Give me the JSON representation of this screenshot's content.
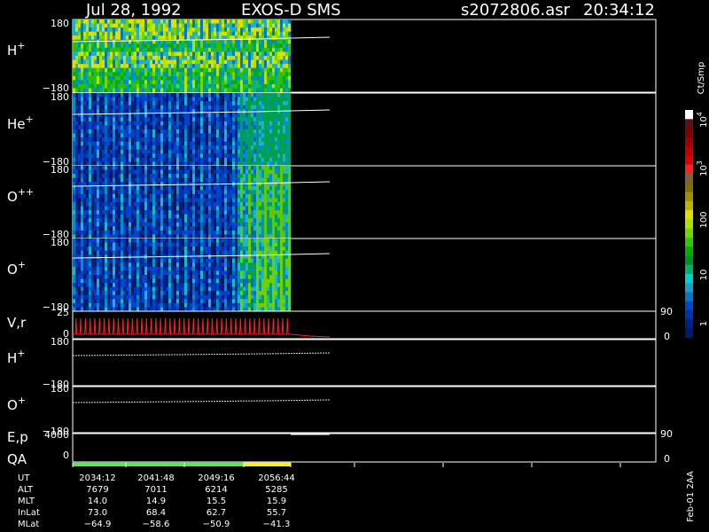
{
  "header": {
    "date": "Jul 28, 1992",
    "instrument": "EXOS-D SMS",
    "filename": "s2072806.asr",
    "time": "20:34:12"
  },
  "colors": {
    "axis": "#ffffff",
    "background": "#000000",
    "qa_green": "#59e852",
    "qa_yellow": "#f5ee2d",
    "red_trace": "#ff2020"
  },
  "panels": [
    {
      "label_main": "H",
      "label_sup": "+",
      "ymax": "180",
      "ymin": "−180"
    },
    {
      "label_main": "He",
      "label_sup": "+",
      "ymax": "180",
      "ymin": "−180"
    },
    {
      "label_main": "O",
      "label_sup": "++",
      "ymax": "180",
      "ymin": "−180"
    },
    {
      "label_main": "O",
      "label_sup": "+",
      "ymax": "180",
      "ymin": "−180"
    }
  ],
  "lower_panels": {
    "vr": {
      "label": "V,r",
      "ymax": "25",
      "ymin": "0",
      "right_max": "90",
      "right_min": "0"
    },
    "h_plus": {
      "label_main": "H",
      "label_sup": "+",
      "ymax": "180",
      "ymin": "−180"
    },
    "o_plus": {
      "label_main": "O",
      "label_sup": "+",
      "ymax": "180",
      "ymin": "−180"
    },
    "ep": {
      "label": "E,p",
      "label2": "QA",
      "ymax": "4000",
      "ymin": "0",
      "right_max": "90",
      "right_min": "0"
    }
  },
  "colorbar": {
    "unit": "Ct/Smp",
    "ticks": [
      {
        "label": "1",
        "base": "1",
        "exp": ""
      },
      {
        "label": "10",
        "base": "10",
        "exp": ""
      },
      {
        "label": "100",
        "base": "100",
        "exp": ""
      },
      {
        "label": "10",
        "base": "10",
        "exp": "3"
      },
      {
        "label": "10",
        "base": "10",
        "exp": "4"
      }
    ],
    "colors": [
      "#001a66",
      "#001f88",
      "#0032aa",
      "#0044cc",
      "#0078c8",
      "#1aa0c8",
      "#00d0d0",
      "#00b070",
      "#009028",
      "#00b000",
      "#30c800",
      "#70d800",
      "#b0e000",
      "#e0e000",
      "#c0b000",
      "#a09000",
      "#807000",
      "#806040",
      "#ff2020",
      "#e00000",
      "#c00000",
      "#a00000",
      "#800000",
      "#601010",
      "#ffffff"
    ]
  },
  "footer": {
    "rows": [
      {
        "name": "UT",
        "values": [
          "2034:12",
          "2041:48",
          "2049:16",
          "2056:44"
        ]
      },
      {
        "name": "ALT",
        "values": [
          "7679",
          "7011",
          "6214",
          "5285"
        ]
      },
      {
        "name": "MLT",
        "values": [
          "14.0",
          "14.9",
          "15.5",
          "15.9"
        ]
      },
      {
        "name": "InLat",
        "values": [
          "73.0",
          "68.4",
          "62.7",
          "55.7"
        ]
      },
      {
        "name": "MLat",
        "values": [
          "−64.9",
          "−58.6",
          "−50.9",
          "−41.3"
        ]
      }
    ],
    "stamp": "Feb-01 2AA"
  },
  "chart_data": {
    "type": "heatmap",
    "x": [
      "2034:12",
      "2041:48",
      "2049:16",
      "2056:44"
    ],
    "panels": [
      {
        "name": "H+",
        "ylim": [
          -180,
          180
        ],
        "median_level": 100
      },
      {
        "name": "He+",
        "ylim": [
          -180,
          180
        ],
        "median_level": 10
      },
      {
        "name": "O++",
        "ylim": [
          -180,
          180
        ],
        "median_level": 10
      },
      {
        "name": "O+",
        "ylim": [
          -180,
          180
        ],
        "median_level": 10
      }
    ],
    "vr": {
      "ylim": [
        0,
        25
      ]
    },
    "ep": {
      "ylim": [
        0,
        4000
      ]
    },
    "colorbar": {
      "scale": "log",
      "min": 1,
      "max": 10000
    }
  }
}
